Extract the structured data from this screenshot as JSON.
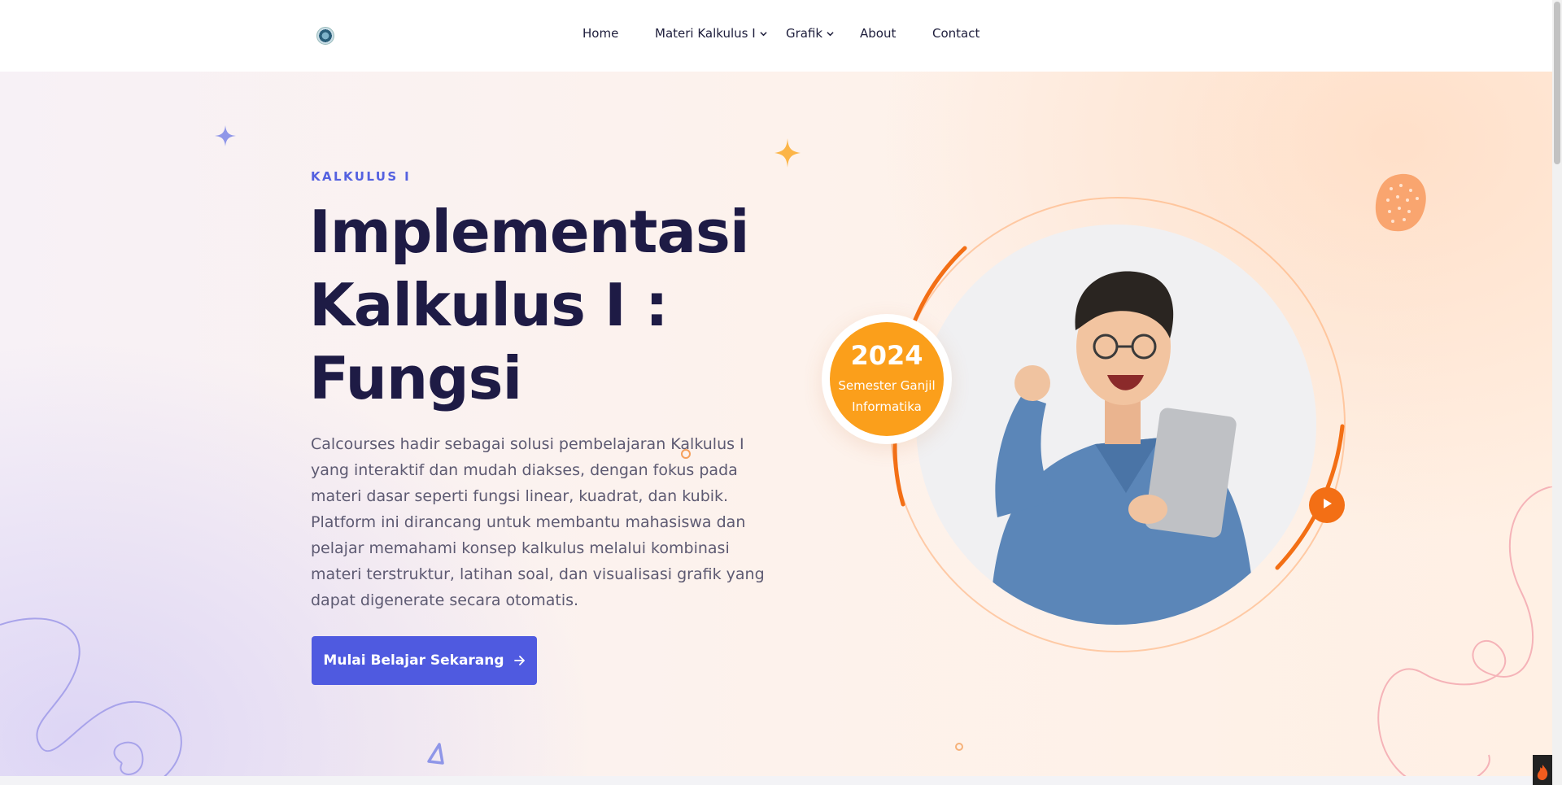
{
  "header": {
    "nav": [
      {
        "label": "Home",
        "has_dropdown": false
      },
      {
        "label": "Materi Kalkulus I",
        "has_dropdown": true
      },
      {
        "label": "Grafik",
        "has_dropdown": true
      },
      {
        "label": "About",
        "has_dropdown": false
      },
      {
        "label": "Contact",
        "has_dropdown": false
      }
    ]
  },
  "hero": {
    "eyebrow": "KALKULUS I",
    "title_line1": "Implementasi",
    "title_line2": "Kalkulus I :",
    "title_line3": "Fungsi",
    "description": "Calcourses hadir sebagai solusi pembelajaran Kalkulus I yang interaktif dan mudah diakses, dengan fokus pada materi dasar seperti fungsi linear, kuadrat, dan kubik. Platform ini dirancang untuk membantu mahasiswa dan pelajar memahami konsep kalkulus melalui kombinasi materi terstruktur, latihan soal, dan visualisasi grafik yang dapat digenerate secara otomatis.",
    "cta_label": "Mulai Belajar Sekarang",
    "badge": {
      "year": "2024",
      "line1": "Semester Ganjil",
      "line2": "Informatika"
    }
  },
  "icons": {
    "logo": "logo-icon",
    "dropdown": "chevron-down-icon",
    "cta_arrow": "arrow-right-icon",
    "play": "play-icon"
  },
  "colors": {
    "primary": "#4f5ae0",
    "title": "#1e1b45",
    "badge": "#fb9f1b",
    "accent_orange": "#f36f15",
    "eyebrow": "#5461e0"
  }
}
